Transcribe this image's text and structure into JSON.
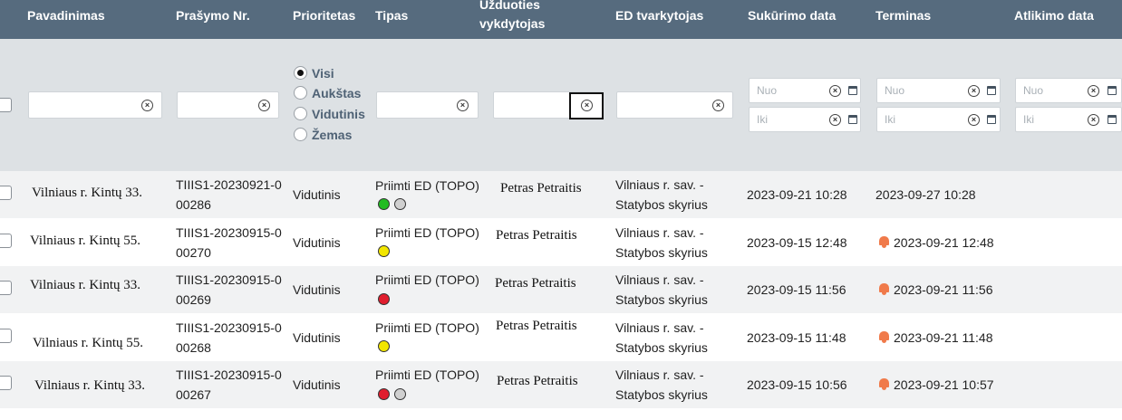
{
  "columns": {
    "pavadinimas": "Pavadinimas",
    "prasymo_nr": "Prašymo Nr.",
    "prioritetas": "Prioritetas",
    "tipas": "Tipas",
    "uzduoties_line1": "Užduoties",
    "uzduoties_line2": "vykdytojas",
    "ed_tvarkytojas": "ED tvarkytojas",
    "sukurimo_data": "Sukūrimo data",
    "terminas": "Terminas",
    "atlikimo_data": "Atlikimo data"
  },
  "filters": {
    "priority_options": [
      "Visi",
      "Aukštas",
      "Vidutinis",
      "Žemas"
    ],
    "priority_selected": "Visi",
    "date_from_placeholder": "Nuo",
    "date_to_placeholder": "Iki"
  },
  "rows": [
    {
      "pavadinimas": "Vilniaus r. Kintų 33.",
      "nr_line1": "TIIIS1-20230921-0",
      "nr_line2": "00286",
      "prioritetas": "Vidutinis",
      "tipas": "Priimti ED (TOPO)",
      "status_dots": [
        "green",
        "grey"
      ],
      "vykdytojas": "Petras Petraitis",
      "ed_line1": "Vilniaus r. sav. -",
      "ed_line2": "Statybos skyrius",
      "sukurimo": "2023-09-21 10:28",
      "terminas": "2023-09-27 10:28",
      "terminas_alert": false,
      "atlikimo": ""
    },
    {
      "pavadinimas": "Vilniaus r. Kintų 55.",
      "nr_line1": "TIIIS1-20230915-0",
      "nr_line2": "00270",
      "prioritetas": "Vidutinis",
      "tipas": "Priimti ED (TOPO)",
      "status_dots": [
        "yellow"
      ],
      "vykdytojas": "Petras Petraitis",
      "ed_line1": "Vilniaus r. sav. -",
      "ed_line2": "Statybos skyrius",
      "sukurimo": "2023-09-15 12:48",
      "terminas": "2023-09-21 12:48",
      "terminas_alert": true,
      "atlikimo": ""
    },
    {
      "pavadinimas": "Vilniaus r. Kintų 33.",
      "nr_line1": "TIIIS1-20230915-0",
      "nr_line2": "00269",
      "prioritetas": "Vidutinis",
      "tipas": "Priimti ED (TOPO)",
      "status_dots": [
        "red"
      ],
      "vykdytojas": "Petras Petraitis",
      "ed_line1": "Vilniaus r. sav. -",
      "ed_line2": "Statybos skyrius",
      "sukurimo": "2023-09-15 11:56",
      "terminas": "2023-09-21 11:56",
      "terminas_alert": true,
      "atlikimo": ""
    },
    {
      "pavadinimas": "Vilniaus r. Kintų 55.",
      "nr_line1": "TIIIS1-20230915-0",
      "nr_line2": "00268",
      "prioritetas": "Vidutinis",
      "tipas": "Priimti ED (TOPO)",
      "status_dots": [
        "yellow"
      ],
      "vykdytojas": "Petras Petraitis",
      "ed_line1": "Vilniaus r. sav. -",
      "ed_line2": "Statybos skyrius",
      "sukurimo": "2023-09-15 11:48",
      "terminas": "2023-09-21 11:48",
      "terminas_alert": true,
      "atlikimo": ""
    },
    {
      "pavadinimas": "Vilniaus r. Kintų 33.",
      "nr_line1": "TIIIS1-20230915-0",
      "nr_line2": "00267",
      "prioritetas": "Vidutinis",
      "tipas": "Priimti ED (TOPO)",
      "status_dots": [
        "red",
        "grey"
      ],
      "vykdytojas": "Petras Petraitis",
      "ed_line1": "Vilniaus r. sav. -",
      "ed_line2": "Statybos skyrius",
      "sukurimo": "2023-09-15 10:56",
      "terminas": "2023-09-21 10:57",
      "terminas_alert": true,
      "atlikimo": ""
    }
  ],
  "colors": {
    "header_bg": "#566b7e",
    "filter_bg": "#dde1e4",
    "green": "#22bb22",
    "yellow": "#f2e600",
    "red": "#e01e2e",
    "grey": "#d0d0d0",
    "alert_bell": "#f07a4a"
  },
  "icons": {
    "clear": "clear-circle-icon",
    "calendar": "calendar-icon",
    "alert": "bell-alert-icon"
  }
}
